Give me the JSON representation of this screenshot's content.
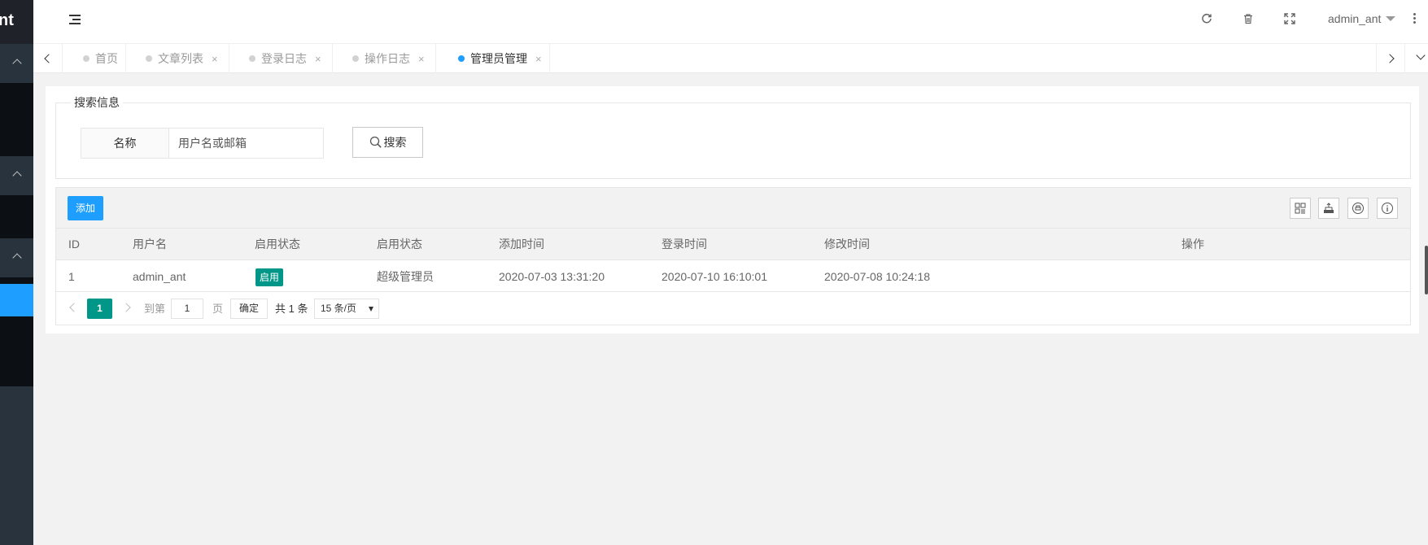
{
  "sidebar": {
    "logo_text": "nt"
  },
  "header": {
    "username": "admin_ant",
    "icons": [
      "flexible-icon",
      "refresh-icon",
      "trash-icon",
      "fullscreen-icon",
      "more-icon"
    ]
  },
  "tabs": [
    {
      "label": "首页",
      "closable": false,
      "active": false
    },
    {
      "label": "文章列表",
      "closable": true,
      "active": false
    },
    {
      "label": "登录日志",
      "closable": true,
      "active": false
    },
    {
      "label": "操作日志",
      "closable": true,
      "active": false
    },
    {
      "label": "管理员管理",
      "closable": true,
      "active": true
    }
  ],
  "tab_close": "×",
  "search": {
    "legend": "搜索信息",
    "field_label": "名称",
    "placeholder": "用户名或邮箱",
    "button_label": "搜索"
  },
  "toolbar": {
    "add_label": "添加"
  },
  "table": {
    "columns": [
      "ID",
      "用户名",
      "启用状态",
      "启用状态",
      "添加时间",
      "登录时间",
      "修改时间",
      "操作"
    ],
    "rows": [
      {
        "id": "1",
        "username": "admin_ant",
        "status": "启用",
        "role": "超级管理员",
        "created": "2020-07-03 13:31:20",
        "login": "2020-07-10 16:10:01",
        "modified": "2020-07-08 10:24:18",
        "actions": ""
      }
    ]
  },
  "pagination": {
    "current": "1",
    "goto_label": "到第",
    "goto_value": "1",
    "page_label": "页",
    "confirm_label": "确定",
    "total_label": "共 1 条",
    "page_size": "15 条/页"
  },
  "colors": {
    "accent": "#1e9fff",
    "success": "#009688",
    "sidebar": "#28333e"
  }
}
